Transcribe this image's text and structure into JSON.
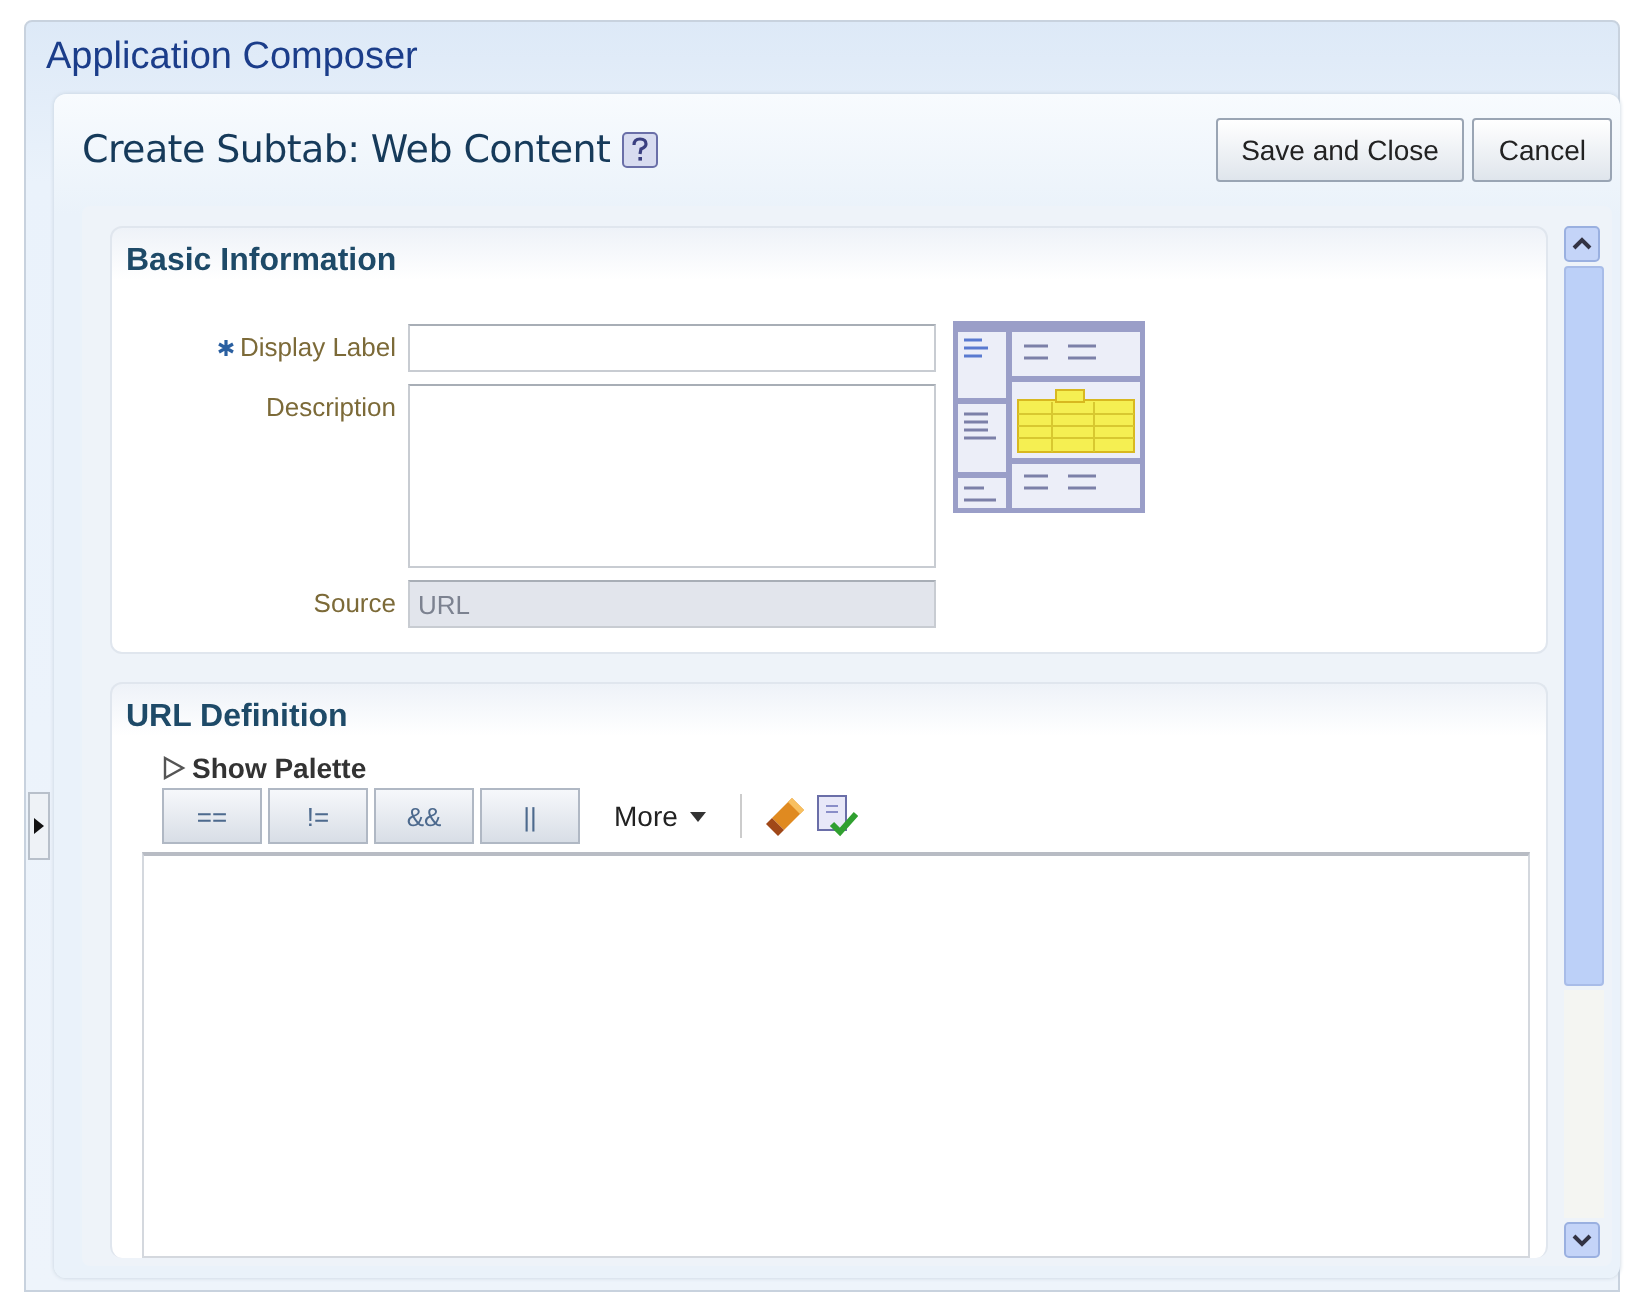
{
  "app_title": "Application Composer",
  "page": {
    "title": "Create Subtab: Web Content",
    "buttons": [
      {
        "label": "Save and Close"
      },
      {
        "label": "Cancel"
      }
    ]
  },
  "basic_information": {
    "title": "Basic Information",
    "fields": [
      {
        "kind": "text",
        "label": "Display Label",
        "required": true
      },
      {
        "kind": "textarea",
        "label": "Description",
        "required": false
      },
      {
        "kind": "readonly",
        "label": "Source",
        "value": "URL",
        "required": false
      }
    ]
  },
  "url_definition": {
    "title": "URL Definition",
    "palette_toggle": "Show Palette",
    "operators": [
      "==",
      "!=",
      "&&",
      "||"
    ],
    "more": "More"
  }
}
